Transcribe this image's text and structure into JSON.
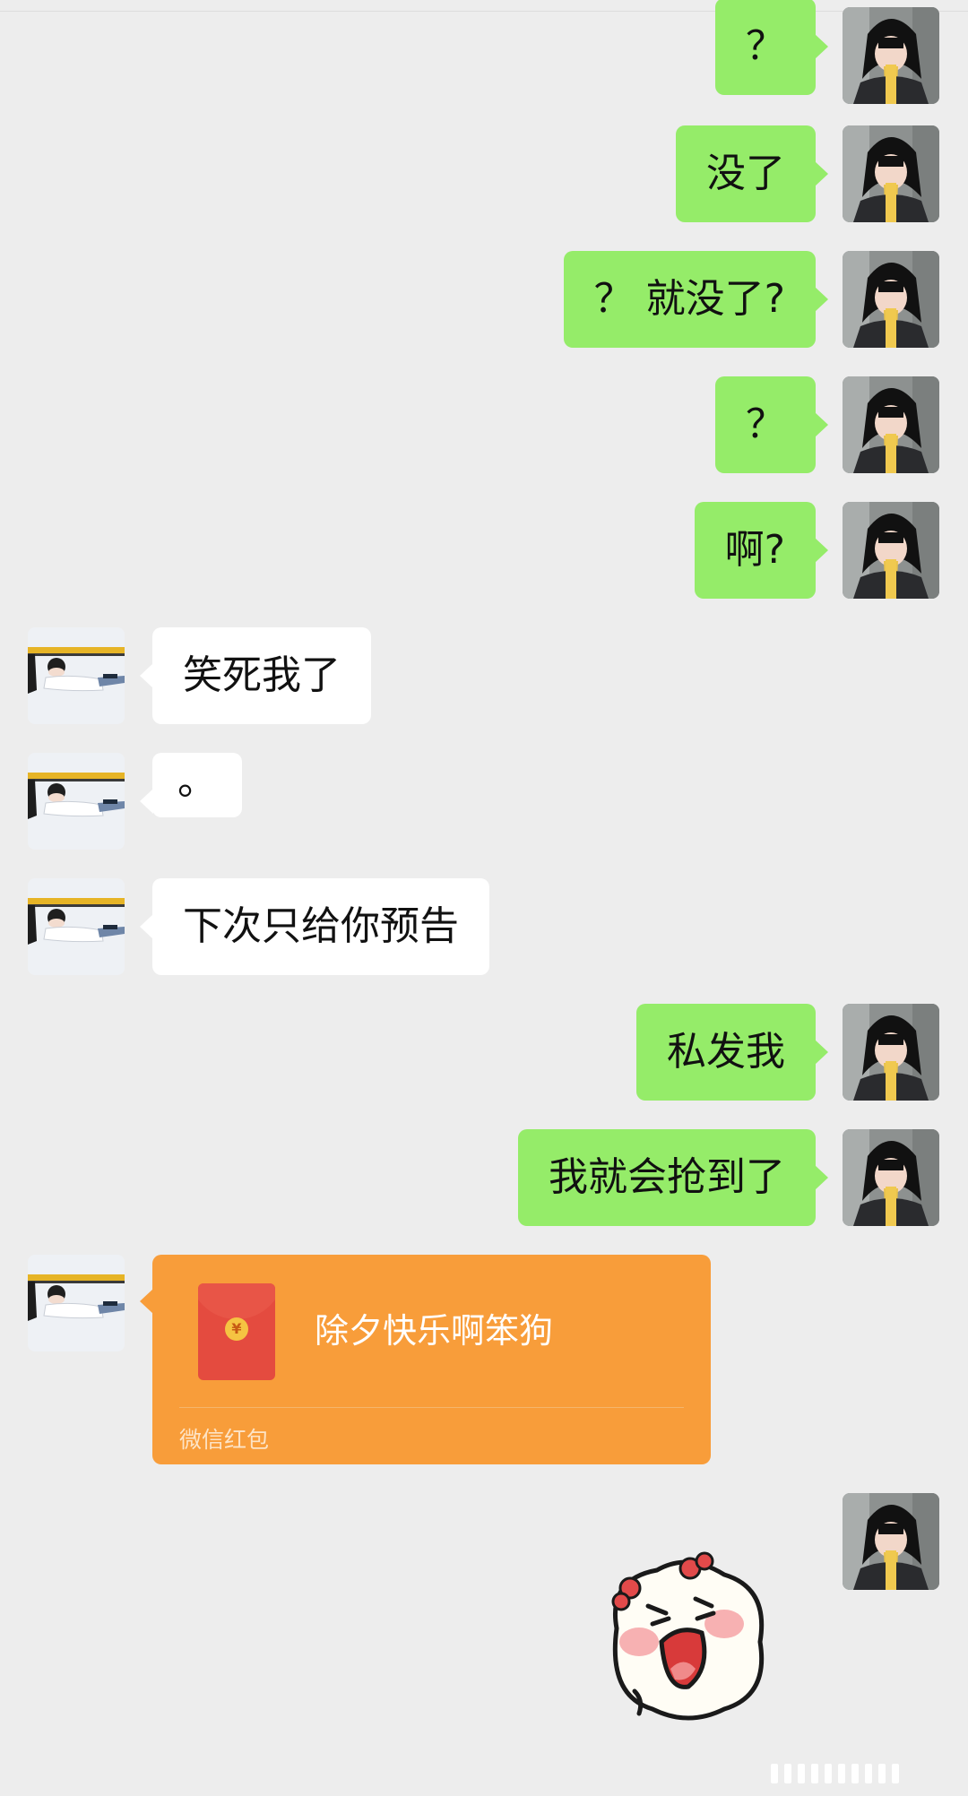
{
  "chat": {
    "messages": [
      {
        "sender": "me",
        "text": "？"
      },
      {
        "sender": "me",
        "text": "没了"
      },
      {
        "sender": "me",
        "text": "？ 就没了?"
      },
      {
        "sender": "me",
        "text": "？"
      },
      {
        "sender": "me",
        "text": "啊?"
      },
      {
        "sender": "them",
        "text": "笑死我了"
      },
      {
        "sender": "them",
        "text": "。"
      },
      {
        "sender": "them",
        "text": "下次只给你预告"
      },
      {
        "sender": "me",
        "text": "私发我"
      },
      {
        "sender": "me",
        "text": "我就会抢到了"
      }
    ],
    "red_packet": {
      "sender": "them",
      "title": "除夕快乐啊笨狗",
      "label": "微信红包",
      "coin_symbol": "¥"
    },
    "sticker": {
      "sender": "me",
      "icon": "crying-bun-sticker"
    }
  },
  "colors": {
    "background": "#ededed",
    "my_bubble": "#95ec69",
    "their_bubble": "#ffffff",
    "red_packet": "#f89d3a"
  }
}
